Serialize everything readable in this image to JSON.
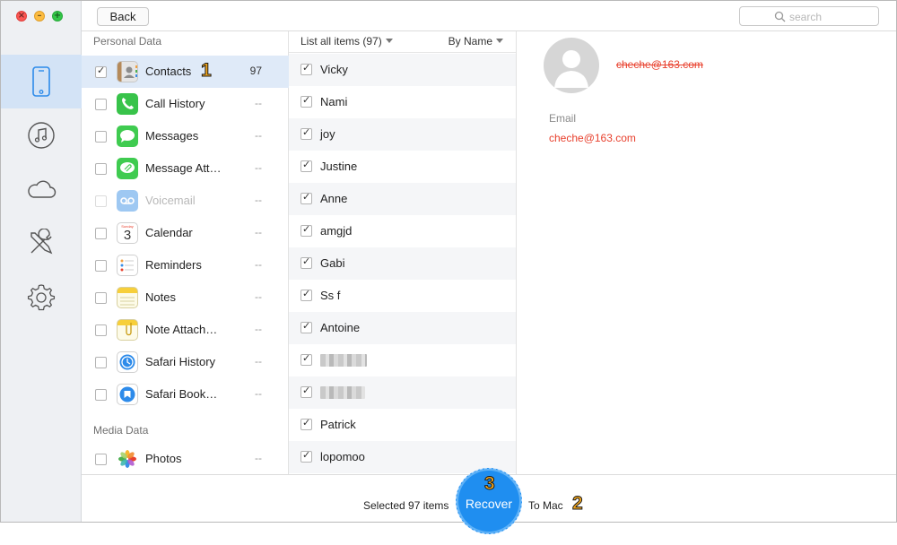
{
  "window": {
    "back_label": "Back",
    "search_placeholder": "search"
  },
  "rail": {
    "items": [
      {
        "icon": "iphone-icon",
        "active": true
      },
      {
        "icon": "music-icon",
        "active": false
      },
      {
        "icon": "cloud-icon",
        "active": false
      },
      {
        "icon": "tools-icon",
        "active": false
      },
      {
        "icon": "gear-icon",
        "active": false
      }
    ]
  },
  "categories": {
    "personal_label": "Personal Data",
    "media_label": "Media Data",
    "items": [
      {
        "label": "Contacts",
        "count": "97",
        "checked": true,
        "icon": "contacts-icon"
      },
      {
        "label": "Call History",
        "count": "--",
        "checked": false,
        "icon": "phone-icon"
      },
      {
        "label": "Messages",
        "count": "--",
        "checked": false,
        "icon": "messages-icon"
      },
      {
        "label": "Message Att…",
        "count": "--",
        "checked": false,
        "icon": "message-attachment-icon"
      },
      {
        "label": "Voicemail",
        "count": "--",
        "checked": false,
        "icon": "voicemail-icon"
      },
      {
        "label": "Calendar",
        "count": "--",
        "checked": false,
        "icon": "calendar-icon"
      },
      {
        "label": "Reminders",
        "count": "--",
        "checked": false,
        "icon": "reminders-icon"
      },
      {
        "label": "Notes",
        "count": "--",
        "checked": false,
        "icon": "notes-icon"
      },
      {
        "label": "Note Attach…",
        "count": "--",
        "checked": false,
        "icon": "note-attachment-icon"
      },
      {
        "label": "Safari History",
        "count": "--",
        "checked": false,
        "icon": "safari-history-icon"
      },
      {
        "label": "Safari Book…",
        "count": "--",
        "checked": false,
        "icon": "safari-bookmark-icon"
      }
    ],
    "media_items": [
      {
        "label": "Photos",
        "count": "--",
        "checked": false,
        "icon": "photos-icon"
      }
    ],
    "calendar_day": "3",
    "calendar_weekday": "Sunday"
  },
  "annotations": {
    "step1": "1",
    "step2": "2",
    "step3": "3"
  },
  "list": {
    "header": "List all items (97)",
    "sort": "By Name",
    "items": [
      {
        "name": "Vicky"
      },
      {
        "name": "Nami"
      },
      {
        "name": "joy"
      },
      {
        "name": "Justine"
      },
      {
        "name": "Anne"
      },
      {
        "name": "amgjd"
      },
      {
        "name": "Gabi"
      },
      {
        "name": "Ss f"
      },
      {
        "name": "Antoine"
      },
      {
        "name": ""
      },
      {
        "name": ""
      },
      {
        "name": "Patrick"
      },
      {
        "name": "lopomoo"
      }
    ]
  },
  "detail": {
    "name": "cheche@163.com",
    "email_label": "Email",
    "email_value": "cheche@163.com"
  },
  "footer": {
    "selected": "Selected 97 items",
    "recover": "Recover",
    "destination": "To Mac"
  },
  "colors": {
    "accent": "#1f8ef0",
    "highlight": "#e8402d",
    "annotation": "#f2a51a"
  }
}
